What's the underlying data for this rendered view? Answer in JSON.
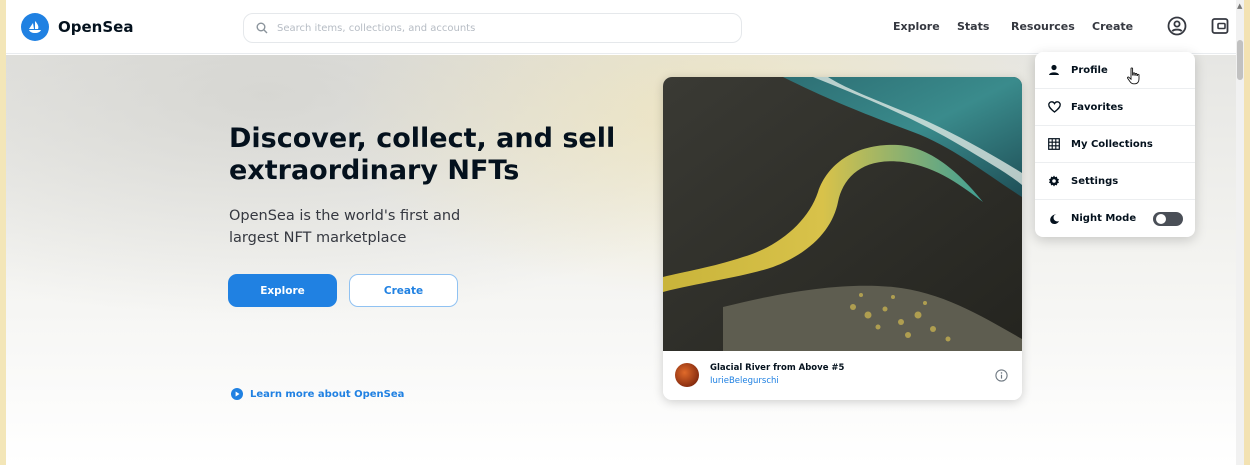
{
  "brand": {
    "name": "OpenSea",
    "accent": "#2081e2",
    "logo_icon": "opensea-logo-icon"
  },
  "search": {
    "placeholder": "Search items, collections, and accounts",
    "icon": "search-icon"
  },
  "nav": {
    "explore": "Explore",
    "stats": "Stats",
    "resources": "Resources",
    "create": "Create"
  },
  "header_icons": {
    "profile": "profile-circle-icon",
    "wallet": "wallet-icon"
  },
  "hero": {
    "title": "Discover, collect, and sell extraordinary NFTs",
    "subtitle": "OpenSea is the world's first and largest NFT marketplace",
    "explore_button": "Explore",
    "create_button": "Create",
    "learn_more": "Learn more about OpenSea"
  },
  "featured": {
    "name": "Glacial River from Above #5",
    "creator": "IurieBelegurschi",
    "info_icon": "info-icon"
  },
  "profile_menu": {
    "items": [
      {
        "label": "Profile",
        "icon": "person-icon"
      },
      {
        "label": "Favorites",
        "icon": "heart-icon"
      },
      {
        "label": "My Collections",
        "icon": "grid-icon"
      },
      {
        "label": "Settings",
        "icon": "gear-icon"
      },
      {
        "label": "Night Mode",
        "icon": "moon-icon",
        "toggle": "off"
      }
    ]
  }
}
